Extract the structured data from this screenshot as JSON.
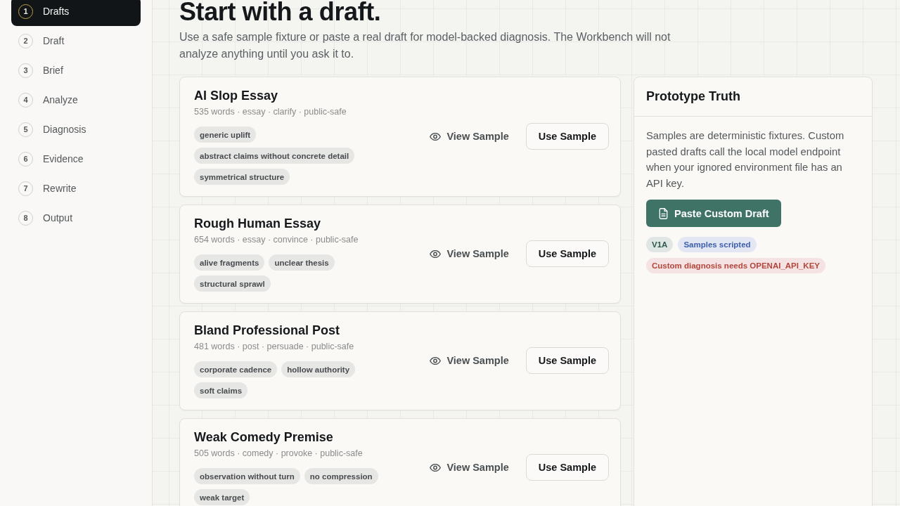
{
  "sidebar": {
    "steps": [
      {
        "number": "1",
        "label": "Drafts",
        "selected": true
      },
      {
        "number": "2",
        "label": "Draft",
        "selected": false
      },
      {
        "number": "3",
        "label": "Brief",
        "selected": false
      },
      {
        "number": "4",
        "label": "Analyze",
        "selected": false
      },
      {
        "number": "5",
        "label": "Diagnosis",
        "selected": false
      },
      {
        "number": "6",
        "label": "Evidence",
        "selected": false
      },
      {
        "number": "7",
        "label": "Rewrite",
        "selected": false
      },
      {
        "number": "8",
        "label": "Output",
        "selected": false
      }
    ]
  },
  "header": {
    "title": "Start with a draft.",
    "subtitle": "Use a safe sample fixture or paste a real draft for model-backed diagnosis. The Workbench will not analyze anything until you ask it to."
  },
  "samples": [
    {
      "title": "AI Slop Essay",
      "meta": "535 words · essay · clarify · public-safe",
      "tags": [
        "generic uplift",
        "abstract claims without concrete detail",
        "symmetrical structure"
      ],
      "view_label": "View Sample",
      "use_label": "Use Sample"
    },
    {
      "title": "Rough Human Essay",
      "meta": "654 words · essay · convince · public-safe",
      "tags": [
        "alive fragments",
        "unclear thesis",
        "structural sprawl"
      ],
      "view_label": "View Sample",
      "use_label": "Use Sample"
    },
    {
      "title": "Bland Professional Post",
      "meta": "481 words · post · persuade · public-safe",
      "tags": [
        "corporate cadence",
        "hollow authority",
        "soft claims"
      ],
      "view_label": "View Sample",
      "use_label": "Use Sample"
    },
    {
      "title": "Weak Comedy Premise",
      "meta": "505 words · comedy · provoke · public-safe",
      "tags": [
        "observation without turn",
        "no compression",
        "weak target"
      ],
      "view_label": "View Sample",
      "use_label": "Use Sample"
    }
  ],
  "panel": {
    "title": "Prototype Truth",
    "text": "Samples are deterministic fixtures. Custom pasted drafts call the local model endpoint when your ignored environment file has an API key.",
    "button": "Paste Custom Draft",
    "badges": [
      {
        "label": "V1A",
        "color": "#2f5a4c"
      },
      {
        "label": "Samples scripted",
        "color": "#3d5fae"
      },
      {
        "label": "Custom diagnosis needs OPENAI_API_KEY",
        "color": "#b3463c"
      }
    ]
  }
}
